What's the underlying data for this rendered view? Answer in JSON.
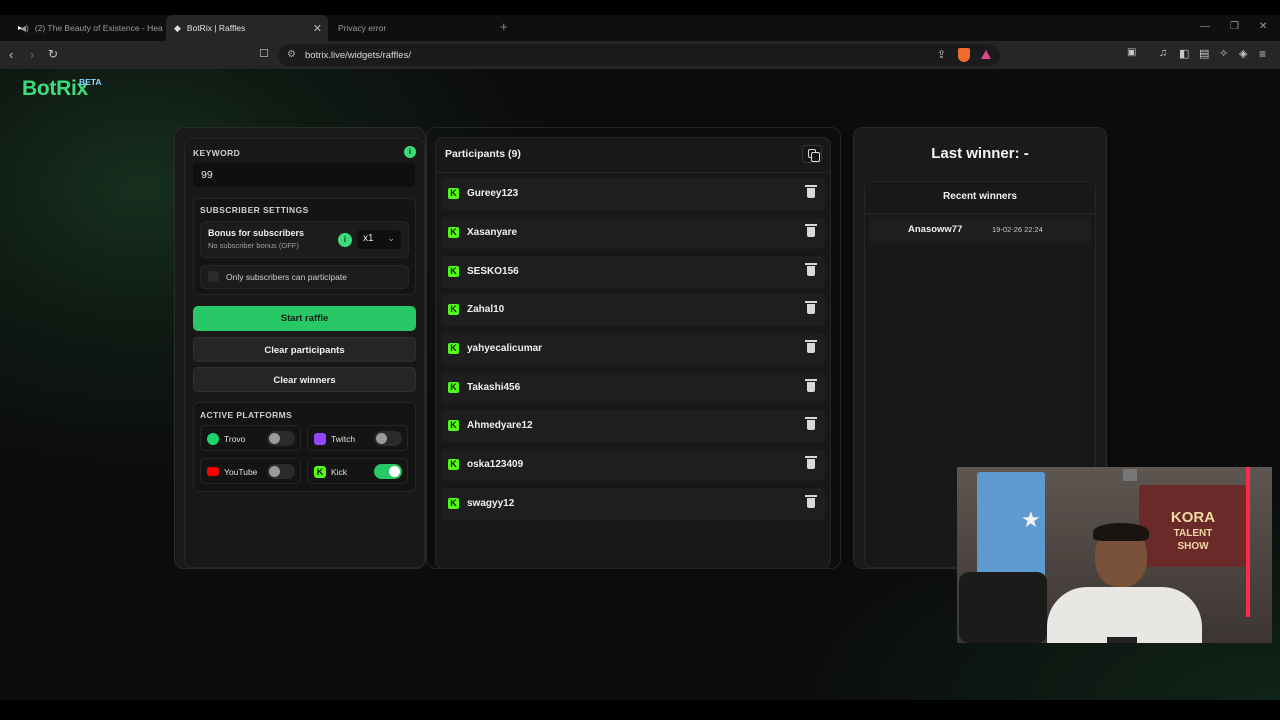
{
  "browser": {
    "tabs": [
      {
        "label": "(2) The Beauty of Existence - Hea",
        "active": false
      },
      {
        "label": "BotRix | Raffles",
        "active": true
      },
      {
        "label": "Privacy error",
        "active": false
      }
    ],
    "url": "botrix.live/widgets/raffles/"
  },
  "app": {
    "logo": "BotRix",
    "beta": "BETA"
  },
  "settings": {
    "keyword_label": "KEYWORD",
    "keyword_value": "99",
    "subscriber_settings_label": "SUBSCRIBER SETTINGS",
    "bonus_title": "Bonus for subscribers",
    "bonus_subtitle": "No subscriber bonus (OFF)",
    "multiplier": "x1",
    "only_subscribers_label": "Only subscribers can participate",
    "only_subscribers_checked": false,
    "start_raffle": "Start raffle",
    "clear_participants": "Clear participants",
    "clear_winners": "Clear winners",
    "active_platforms_label": "ACTIVE PLATFORMS",
    "platforms": [
      {
        "name": "Trovo",
        "enabled": false,
        "color": "#19d66b"
      },
      {
        "name": "Twitch",
        "enabled": false,
        "color": "#9146ff"
      },
      {
        "name": "YouTube",
        "enabled": false,
        "color": "#ff0000"
      },
      {
        "name": "Kick",
        "enabled": true,
        "color": "#53fc18"
      }
    ]
  },
  "participants": {
    "title": "Participants (9)",
    "items": [
      "Gureey123",
      "Xasanyare",
      "SESKO156",
      "Zahal10",
      "yahyecalicumar",
      "Takashi456",
      "Ahmedyare12",
      "oska123409",
      "swagyy12"
    ]
  },
  "winners": {
    "last_winner": "Last winner: -",
    "recent_title": "Recent winners",
    "recent": [
      {
        "name": "Anasoww77",
        "time": "19-02-26 22:24"
      }
    ]
  },
  "webcam": {
    "poster_line1": "KORA",
    "poster_line2": "TALENT",
    "poster_line3": "SHOW"
  },
  "colors": {
    "accent_green": "#27c865",
    "logo_green": "#3ddc7a",
    "kick_green": "#53fc18"
  }
}
